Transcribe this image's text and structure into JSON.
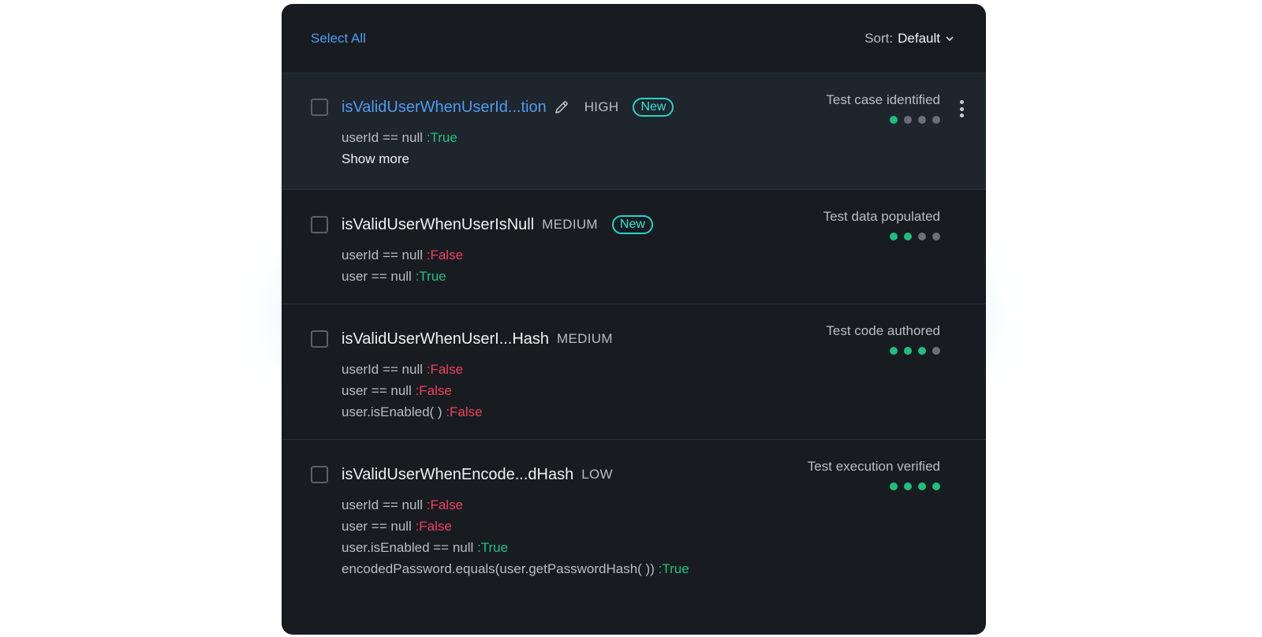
{
  "toolbar": {
    "select_all": "Select All",
    "sort_label": "Sort:",
    "sort_value": "Default"
  },
  "rows": [
    {
      "title": "isValidUserWhenUserId...tion",
      "priority": "HIGH",
      "badge": "New",
      "conditions": [
        {
          "expr": "userId == null",
          "result": ":True"
        }
      ],
      "show_more": "Show more",
      "status": "Test case identified",
      "progress": 1
    },
    {
      "title": "isValidUserWhenUserIsNull",
      "priority": "MEDIUM",
      "badge": "New",
      "conditions": [
        {
          "expr": "userId == null",
          "result": ":False"
        },
        {
          "expr": "user == null",
          "result": ":True"
        }
      ],
      "status": "Test data populated",
      "progress": 2
    },
    {
      "title": "isValidUserWhenUserI...Hash",
      "priority": "MEDIUM",
      "conditions": [
        {
          "expr": "userId == null",
          "result": ":False"
        },
        {
          "expr": "user == null",
          "result": ":False"
        },
        {
          "expr": "user.isEnabled( )",
          "result": ":False"
        }
      ],
      "status": "Test code authored",
      "progress": 3
    },
    {
      "title": "isValidUserWhenEncode...dHash",
      "priority": "LOW",
      "conditions": [
        {
          "expr": "userId == null",
          "result": ":False"
        },
        {
          "expr": "user == null",
          "result": ":False"
        },
        {
          "expr": "user.isEnabled == null",
          "result": ":True"
        },
        {
          "expr": "encodedPassword.equals(user.getPasswordHash( ))",
          "result": ":True"
        }
      ],
      "status": "Test execution verified",
      "progress": 4
    }
  ],
  "colors": {
    "panel": "#181c21",
    "accent_blue": "#4f9bf0",
    "true_green": "#21c181",
    "false_red": "#f0415b",
    "badge_teal": "#29d3c7"
  },
  "icons": {
    "edit": "pencil-icon",
    "sort": "chevron-down-icon",
    "menu": "kebab-menu-icon"
  }
}
